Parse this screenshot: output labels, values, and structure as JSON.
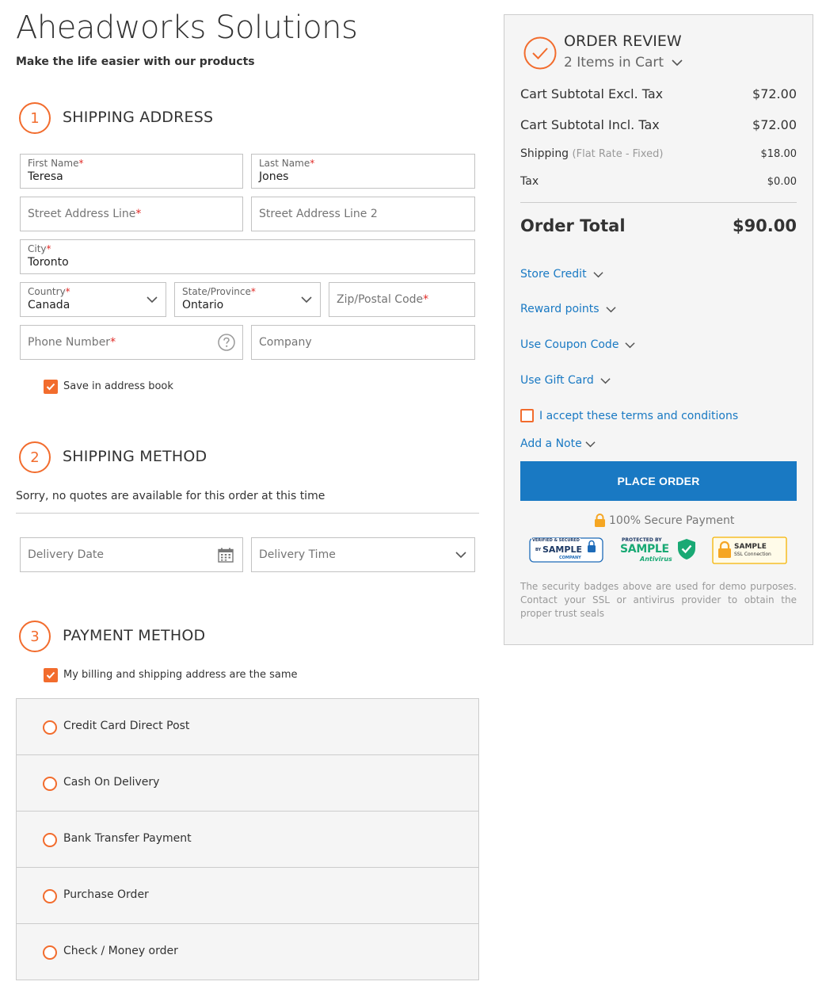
{
  "header": {
    "store_title": "Aheadworks Solutions",
    "store_subtitle": "Make the life easier with our products"
  },
  "shipping_address": {
    "step_number": "1",
    "title": "SHIPPING ADDRESS",
    "first_name": {
      "label": "First Name",
      "value": "Teresa"
    },
    "last_name": {
      "label": "Last Name",
      "value": "Jones"
    },
    "street1": {
      "placeholder": "Street Address Line"
    },
    "street2": {
      "placeholder": "Street Address Line 2"
    },
    "city": {
      "label": "City",
      "value": "Toronto"
    },
    "country": {
      "label": "Country",
      "value": "Canada"
    },
    "state": {
      "label": "State/Province",
      "value": "Ontario"
    },
    "zip": {
      "placeholder": "Zip/Postal Code"
    },
    "phone": {
      "placeholder": "Phone Number"
    },
    "company": {
      "placeholder": "Company"
    },
    "save_in_address_book": {
      "label": "Save in address book",
      "checked": true
    },
    "required_marker": "*"
  },
  "shipping_method": {
    "step_number": "2",
    "title": "SHIPPING METHOD",
    "notice": "Sorry, no quotes are available for this order at this time",
    "delivery_date": {
      "placeholder": "Delivery Date"
    },
    "delivery_time": {
      "placeholder": "Delivery Time"
    }
  },
  "payment_method": {
    "step_number": "3",
    "title": "PAYMENT METHOD",
    "billing_same": {
      "label": "My billing and shipping address are the same",
      "checked": true
    },
    "options": [
      {
        "label": "Credit Card Direct Post"
      },
      {
        "label": "Cash On Delivery"
      },
      {
        "label": "Bank Transfer Payment"
      },
      {
        "label": "Purchase Order"
      },
      {
        "label": "Check / Money order"
      }
    ]
  },
  "order_review": {
    "title": "ORDER REVIEW",
    "items_in_cart": "2 Items in Cart",
    "rows": [
      {
        "label": "Cart Subtotal Excl. Tax",
        "value": "$72.00"
      },
      {
        "label": "Cart Subtotal Incl. Tax",
        "value": "$72.00"
      }
    ],
    "shipping": {
      "label": "Shipping",
      "note": "(Flat Rate - Fixed)",
      "value": "$18.00"
    },
    "tax": {
      "label": "Tax",
      "value": "$0.00"
    },
    "order_total": {
      "label": "Order Total",
      "value": "$90.00"
    },
    "links": {
      "store_credit": "Store Credit",
      "reward_points": "Reward points",
      "coupon": "Use Coupon Code",
      "gift_card": "Use Gift Card",
      "add_note": "Add a Note"
    },
    "terms": {
      "label": "I accept these terms and conditions",
      "checked": false
    },
    "place_order_label": "PLACE ORDER",
    "secure_payment": "100% Secure Payment",
    "badges": {
      "b1_top": "VERIFIED & SECURED",
      "b1_by": "BY",
      "b1_main": "SAMPLE",
      "b1_bottom": "COMPANY",
      "b2_top": "PROTECTED BY",
      "b2_main": "SAMPLE",
      "b2_bottom": "Antivirus",
      "b3_main": "SAMPLE",
      "b3_bottom": "SSL Connection"
    },
    "disclaimer": "The security badges above are used for demo purposes. Contact your SSL or antivirus provider to obtain the proper trust seals"
  },
  "colors": {
    "accent": "#f26c2d",
    "primary_button": "#1979c3",
    "link": "#1979c3",
    "required": "#e02b27"
  }
}
